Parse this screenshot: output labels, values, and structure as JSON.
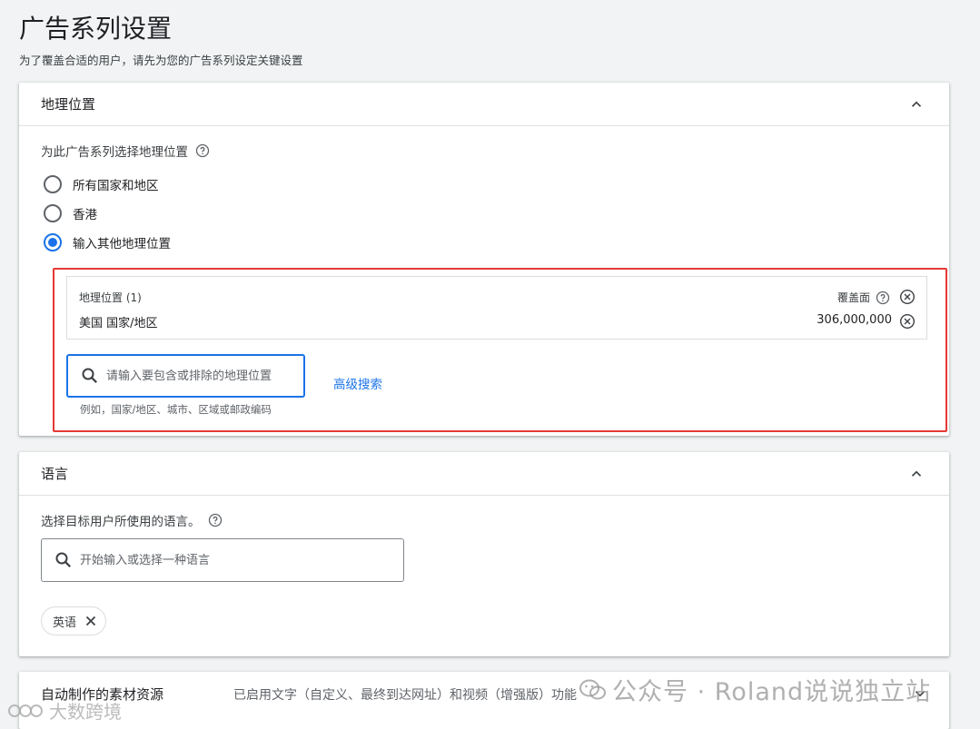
{
  "page": {
    "title": "广告系列设置",
    "subtitle": "为了覆盖合适的用户，请先为您的广告系列设定关键设置"
  },
  "geo": {
    "header": "地理位置",
    "question": "为此广告系列选择地理位置",
    "options": [
      {
        "label": "所有国家和地区",
        "selected": false
      },
      {
        "label": "香港",
        "selected": false
      },
      {
        "label": "输入其他地理位置",
        "selected": true
      }
    ],
    "targeted": {
      "heading": "地理位置 (1)",
      "coverage_label": "覆盖面",
      "location": "美国 国家/地区",
      "reach": "306,000,000"
    },
    "search_placeholder": "请输入要包含或排除的地理位置",
    "advanced_search": "高级搜索",
    "hint": "例如，国家/地区、城市、区域或邮政编码"
  },
  "language": {
    "header": "语言",
    "question": "选择目标用户所使用的语言。",
    "search_placeholder": "开始输入或选择一种语言",
    "chip": "英语"
  },
  "assets": {
    "header": "自动制作的素材资源",
    "status": "已启用文字（自定义、最终到达网址）和视频（增强版）功能"
  },
  "watermarks": {
    "right": "公众号 · Roland说说独立站",
    "left": "大数跨境"
  },
  "colors": {
    "accent": "#1a73e8",
    "highlight_border": "#e53935"
  }
}
